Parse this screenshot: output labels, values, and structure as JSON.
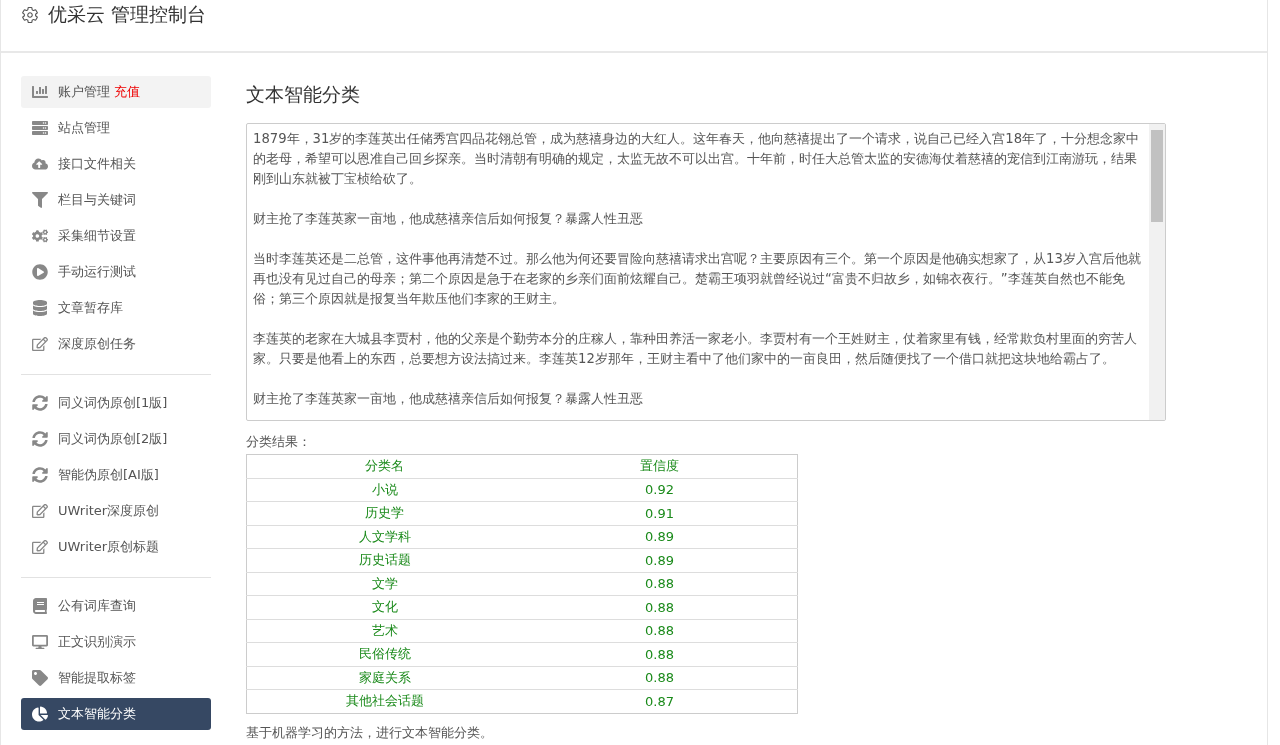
{
  "header": {
    "title": "优采云 管理控制台"
  },
  "sidebar": {
    "groups": [
      {
        "items": [
          {
            "label": "账户管理",
            "badge": "充值",
            "selected": false,
            "hover": true
          },
          {
            "label": "站点管理",
            "selected": false
          },
          {
            "label": "接口文件相关",
            "selected": false
          },
          {
            "label": "栏目与关键词",
            "selected": false
          },
          {
            "label": "采集细节设置",
            "selected": false
          },
          {
            "label": "手动运行测试",
            "selected": false
          },
          {
            "label": "文章暂存库",
            "selected": false
          },
          {
            "label": "深度原创任务",
            "selected": false
          }
        ]
      },
      {
        "items": [
          {
            "label": "同义词伪原创[1版]",
            "selected": false
          },
          {
            "label": "同义词伪原创[2版]",
            "selected": false
          },
          {
            "label": "智能伪原创[AI版]",
            "selected": false
          },
          {
            "label": "UWriter深度原创",
            "selected": false
          },
          {
            "label": "UWriter原创标题",
            "selected": false
          }
        ]
      },
      {
        "items": [
          {
            "label": "公有词库查询",
            "selected": false
          },
          {
            "label": "正文识别演示",
            "selected": false
          },
          {
            "label": "智能提取标签",
            "selected": false
          },
          {
            "label": "文本智能分类",
            "selected": true
          }
        ]
      }
    ]
  },
  "main": {
    "title": "文本智能分类",
    "text": [
      "1879年，31岁的李莲英出任储秀宫四品花翎总管，成为慈禧身边的大红人。这年春天，他向慈禧提出了一个请求，说自己已经入宫18年了，十分想念家中的老母，希望可以恩准自己回乡探亲。当时清朝有明确的规定，太监无故不可以出宫。十年前，时任大总管太监的安德海仗着慈禧的宠信到江南游玩，结果刚到山东就被丁宝桢给砍了。",
      "财主抢了李莲英家一亩地，他成慈禧亲信后如何报复？暴露人性丑恶",
      "当时李莲英还是二总管，这件事他再清楚不过。那么他为何还要冒险向慈禧请求出宫呢？主要原因有三个。第一个原因是他确实想家了，从13岁入宫后他就再也没有见过自己的母亲；第二个原因是急于在老家的乡亲们面前炫耀自己。楚霸王项羽就曾经说过“富贵不归故乡，如锦衣夜行。”李莲英自然也不能免俗；第三个原因就是报复当年欺压他们李家的王财主。",
      "李莲英的老家在大城县李贾村，他的父亲是个勤劳本分的庄稼人，靠种田养活一家老小。李贾村有一个王姓财主，仗着家里有钱，经常欺负村里面的穷苦人家。只要是他看上的东西，总要想方设法搞过来。李莲英12岁那年，王财主看中了他们家中的一亩良田，然后随便找了一个借口就把这块地给霸占了。",
      "财主抢了李莲英家一亩地，他成慈禧亲信后如何报复？暴露人性丑恶"
    ],
    "result_title": "分类结果：",
    "table": {
      "columns": [
        "分类名",
        "置信度"
      ],
      "rows": [
        [
          "小说",
          "0.92"
        ],
        [
          "历史学",
          "0.91"
        ],
        [
          "人文学科",
          "0.89"
        ],
        [
          "历史话题",
          "0.89"
        ],
        [
          "文学",
          "0.88"
        ],
        [
          "文化",
          "0.88"
        ],
        [
          "艺术",
          "0.88"
        ],
        [
          "民俗传统",
          "0.88"
        ],
        [
          "家庭关系",
          "0.88"
        ],
        [
          "其他社会话题",
          "0.87"
        ]
      ]
    },
    "footnote": "基于机器学习的方法，进行文本智能分类。"
  }
}
